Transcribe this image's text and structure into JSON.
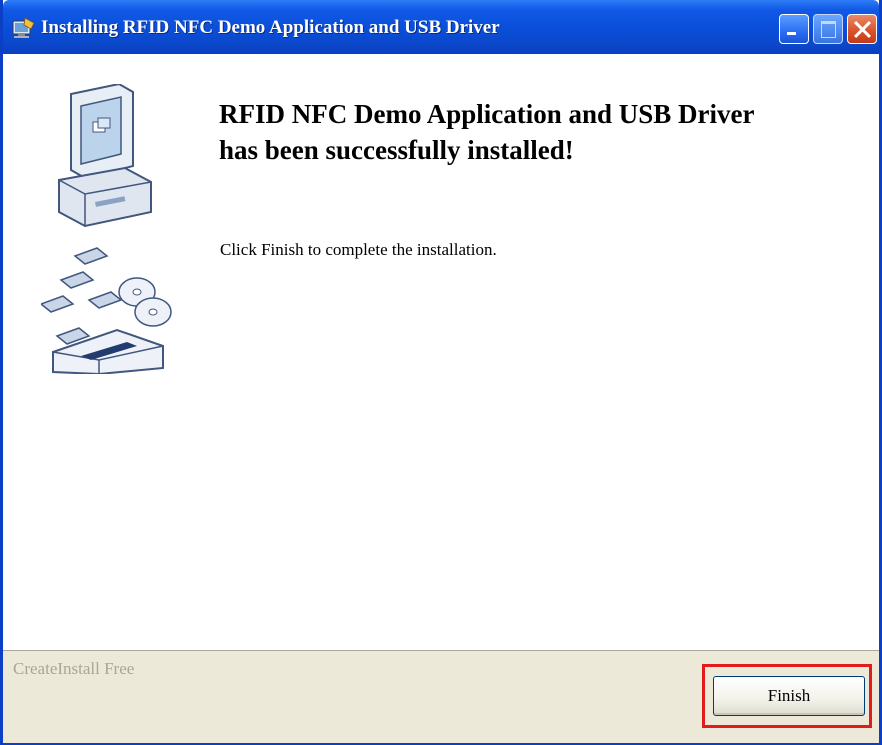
{
  "window": {
    "title": "Installing RFID NFC Demo Application and USB Driver",
    "titlebar_color": "#0a4ed8",
    "controls": {
      "minimize_icon": "minimize-icon",
      "maximize_icon": "maximize-icon",
      "close_icon": "close-icon"
    }
  },
  "main": {
    "heading_line1": "RFID NFC Demo Application and USB Driver",
    "heading_line2": "has been successfully installed!",
    "instruction": "Click Finish to complete the installation.",
    "illustration": "computer-installation-icon"
  },
  "footer": {
    "brand": "CreateInstall Free",
    "finish_label": "Finish",
    "highlight_color": "#e21b1b"
  }
}
